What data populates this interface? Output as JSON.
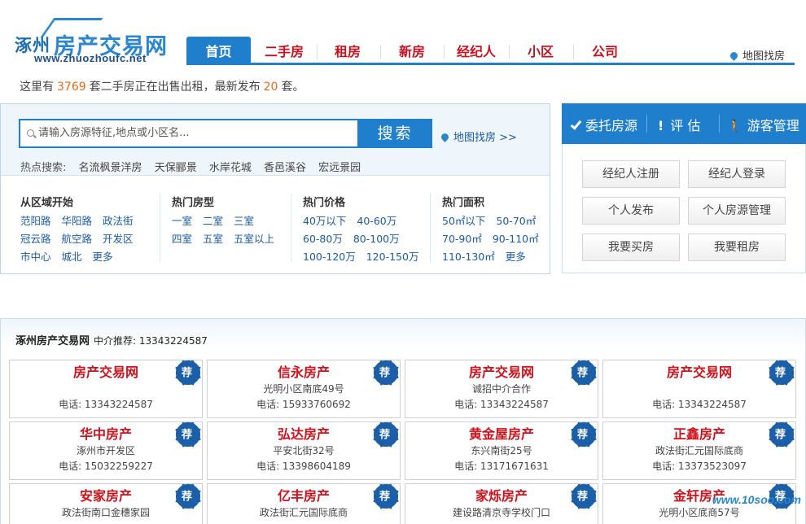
{
  "logo": {
    "city": "涿州",
    "name": "房产交易网",
    "url": "www.zhuozhoufc.net"
  },
  "nav": {
    "items": [
      "首页",
      "二手房",
      "租房",
      "新房",
      "经纪人",
      "小区",
      "公司"
    ],
    "map_link": "地图找房"
  },
  "stats": {
    "prefix": "这里有",
    "count": "3769",
    "middle": "套二手房正在出售出租，最新发布",
    "new_count": "20",
    "suffix": "套。"
  },
  "search": {
    "placeholder": "请输入房源特征,地点或小区名...",
    "button": "搜索",
    "map_link": "地图找房 >>",
    "hot_label": "热点搜索:",
    "hot_keywords": [
      "名流枫景洋房",
      "天保郦景",
      "水岸花城",
      "香邑溪谷",
      "宏远景园"
    ]
  },
  "categories": [
    {
      "title": "从区域开始",
      "rows": [
        [
          "范阳路",
          "华阳路",
          "政法街"
        ],
        [
          "冠云路",
          "航空路",
          "开发区"
        ],
        [
          "市中心",
          "城北",
          "更多"
        ]
      ]
    },
    {
      "title": "热门房型",
      "rows": [
        [
          "一室",
          "二室",
          "三室"
        ],
        [
          "四室",
          "五室",
          "五室以上"
        ]
      ]
    },
    {
      "title": "热门价格",
      "rows": [
        [
          "40万以下",
          "40-60万"
        ],
        [
          "60-80万",
          "80-100万"
        ],
        [
          "100-120万",
          "120-150万"
        ]
      ]
    },
    {
      "title": "热门面积",
      "rows": [
        [
          "50㎡以下",
          "50-70㎡"
        ],
        [
          "70-90㎡",
          "90-110㎡"
        ],
        [
          "110-130㎡",
          "更多"
        ]
      ]
    }
  ],
  "tools": {
    "entrust": "委托房源",
    "assess": "评 估",
    "visitor": "游客管理"
  },
  "actions": [
    "经纪人注册",
    "经纪人登录",
    "个人发布",
    "个人房源管理",
    "我要买房",
    "我要租房"
  ],
  "agency": {
    "title": "涿州房产交易网",
    "subtitle": "中介推荐: 13343224587",
    "badge": "荐",
    "cards": [
      {
        "name": "房产交易网",
        "addr": "",
        "tel": "电话: 13343224587"
      },
      {
        "name": "信永房产",
        "addr": "光明小区南底49号",
        "tel": "电话: 15933760692"
      },
      {
        "name": "房产交易网",
        "addr": "诚招中介合作",
        "tel": "电话: 13343224587"
      },
      {
        "name": "房产交易网",
        "addr": "",
        "tel": "电话: 13343224587"
      },
      {
        "name": "华中房产",
        "addr": "涿州市开发区",
        "tel": "电话: 15032259227"
      },
      {
        "name": "弘达房产",
        "addr": "平安北街32号",
        "tel": "电话: 13398604189"
      },
      {
        "name": "黄金屋房产",
        "addr": "东兴南街25号",
        "tel": "电话: 13171671631"
      },
      {
        "name": "正鑫房产",
        "addr": "政法街汇元国际底商",
        "tel": "电话: 13373523097"
      },
      {
        "name": "安家房产",
        "addr": "政法街南口金穗家园",
        "tel": ""
      },
      {
        "name": "亿丰房产",
        "addr": "政法街汇元国际底商",
        "tel": ""
      },
      {
        "name": "家烁房产",
        "addr": "建设路清京寺学校门口",
        "tel": ""
      },
      {
        "name": "金轩房产",
        "addr": "光明小区底商57号",
        "tel": ""
      }
    ]
  },
  "watermark": "www.10soo.com"
}
